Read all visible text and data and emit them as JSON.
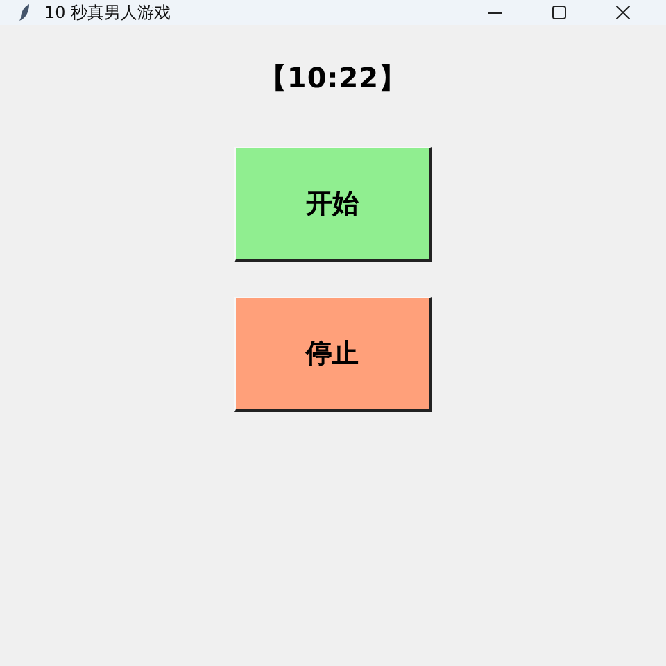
{
  "window": {
    "title": "10 秒真男人游戏"
  },
  "timer": "【10:22】",
  "buttons": [
    {
      "label": "开始",
      "color": "#90ee90"
    },
    {
      "label": "停止",
      "color": "#ffa07a"
    }
  ]
}
